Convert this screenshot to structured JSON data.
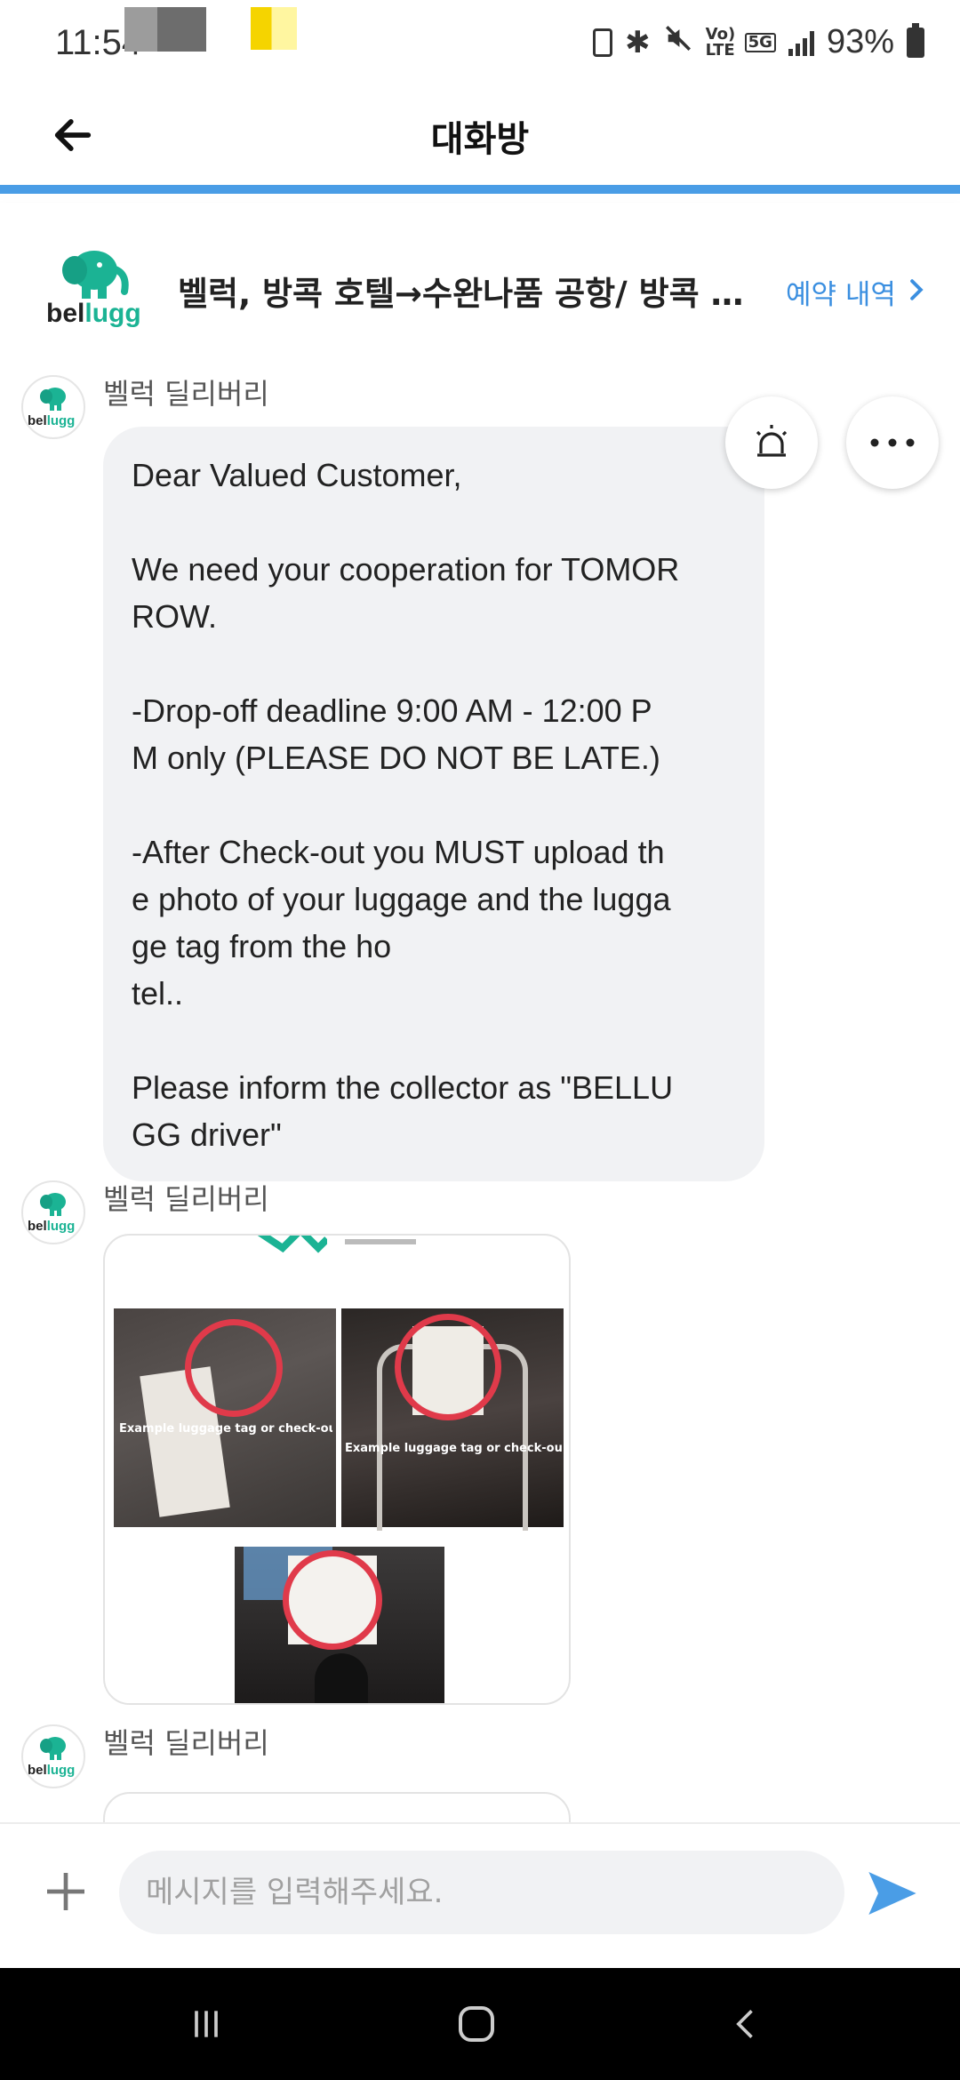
{
  "status_bar": {
    "time": "11:54",
    "network": "5G",
    "volte": "Vo) LTE",
    "battery": "93%"
  },
  "header": {
    "title": "대화방"
  },
  "booking": {
    "title": "벨럭, 방콕 호텔→수완나품 공항/ 방콕 수완나품 공항",
    "link_label": "예약 내역"
  },
  "logo": {
    "wordmark_a": "bel",
    "wordmark_b": "lugg",
    "brand_color": "#1bb394"
  },
  "messages": [
    {
      "sender": "벨럭 딜리버리",
      "type": "text",
      "paragraphs": [
        "Dear Valued Customer,",
        "We need your cooperation for TOMOR\nROW.",
        "-Drop-off deadline 9:00 AM - 12:00 P\nM only (PLEASE DO NOT BE LATE.)",
        "-After Check-out you MUST upload th\ne photo of your luggage and the lugga\nge tag from the ho\ntel..",
        "Please inform the collector as \"BELLU\nGG driver\""
      ]
    },
    {
      "sender": "벨럭 딜리버리",
      "type": "image",
      "image": {
        "caption_left": "Example luggage tag or check-out slip",
        "caption_right": "Example luggage tag or check-out slip"
      }
    },
    {
      "sender": "벨럭 딜리버리",
      "type": "card"
    }
  ],
  "input": {
    "placeholder": "메시지를 입력해주세요."
  },
  "colors": {
    "accent": "#4a9de6",
    "link": "#3b8fe0",
    "bubble": "#f1f2f4",
    "send": "#4a9de6"
  }
}
